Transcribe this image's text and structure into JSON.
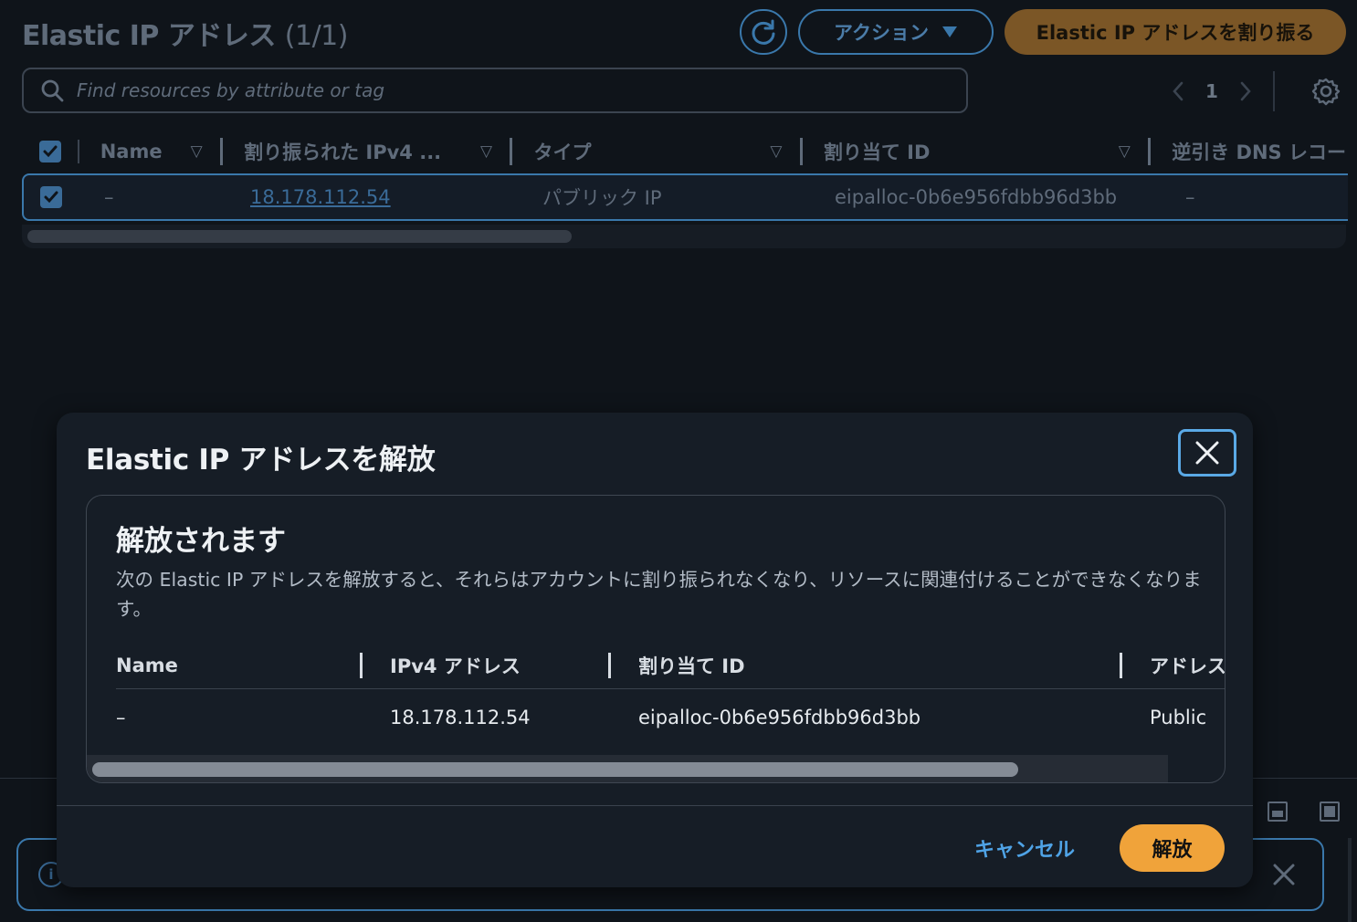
{
  "page": {
    "title": "Elastic IP アドレス",
    "count": "(1/1)",
    "actions_label": "アクション",
    "allocate_label": "Elastic IP アドレスを割り振る",
    "search_placeholder": "Find resources by attribute or tag",
    "page_number": "1"
  },
  "table": {
    "columns": [
      "Name",
      "割り振られた IPv4 ...",
      "タイプ",
      "割り当て ID",
      "逆引き DNS レコー"
    ],
    "row": {
      "name": "–",
      "ip": "18.178.112.54",
      "type": "パブリック IP",
      "allocation_id": "eipalloc-0b6e956fdbb96d3bb",
      "reverse_dns": "–"
    }
  },
  "modal": {
    "title": "Elastic IP アドレスを解放",
    "alert_title": "解放されます",
    "alert_text": "次の Elastic IP アドレスを解放すると、それらはアカウントに割り振られなくなり、リソースに関連付けることができなくなります。",
    "columns": [
      "Name",
      "IPv4 アドレス",
      "割り当て ID",
      "アドレス"
    ],
    "row": {
      "name": "–",
      "ip": "18.178.112.54",
      "allocation_id": "eipalloc-0b6e956fdbb96d3bb",
      "address_type": "Public"
    },
    "cancel_label": "キャンセル",
    "release_label": "解放"
  },
  "colors": {
    "accent_blue": "#5aa9e6",
    "primary_orange": "#f0a33a",
    "background": "#0f141a",
    "modal_bg": "#161d26"
  },
  "icons": [
    "refresh-icon",
    "caret-down-icon",
    "search-icon",
    "chevron-left-icon",
    "chevron-right-icon",
    "gear-icon",
    "checkbox-icon",
    "sort-icon",
    "close-icon",
    "info-icon"
  ]
}
